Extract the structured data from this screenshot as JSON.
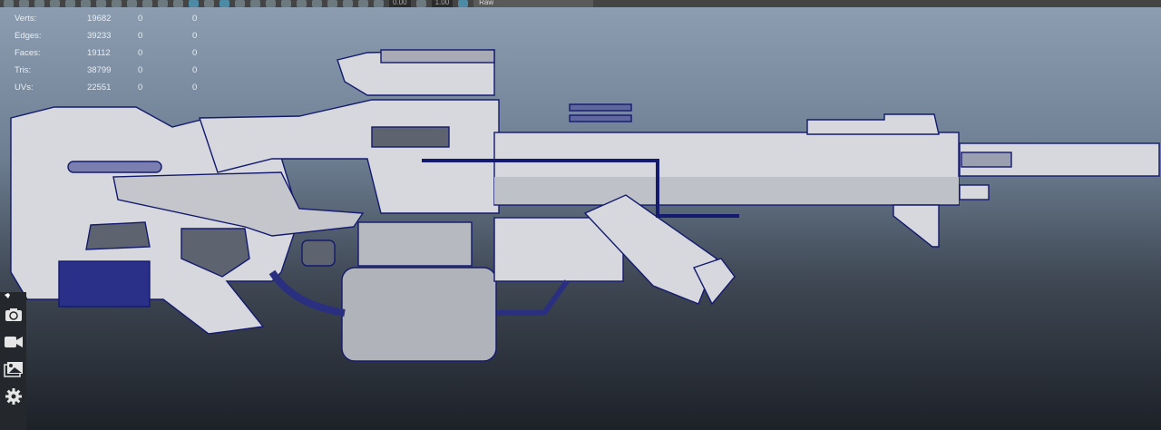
{
  "toolbar": {
    "field_1": "0.00",
    "field_2": "1.00",
    "color_space": "Raw"
  },
  "hud": {
    "rows": [
      {
        "label": "Verts:",
        "value": "19682",
        "a": "0",
        "b": "0"
      },
      {
        "label": "Edges:",
        "value": "39233",
        "a": "0",
        "b": "0"
      },
      {
        "label": "Faces:",
        "value": "19112",
        "a": "0",
        "b": "0"
      },
      {
        "label": "Tris:",
        "value": "38799",
        "a": "0",
        "b": "0"
      },
      {
        "label": "UVs:",
        "value": "22551",
        "a": "0",
        "b": "0"
      }
    ]
  },
  "side_panel": {
    "icons": [
      "pin-icon",
      "camera-icon",
      "video-camera-icon",
      "image-gallery-icon",
      "gear-icon"
    ]
  },
  "colors": {
    "mesh_fill": "#d6d8de",
    "wireframe": "#141a6e",
    "toolbar": "#444444"
  }
}
